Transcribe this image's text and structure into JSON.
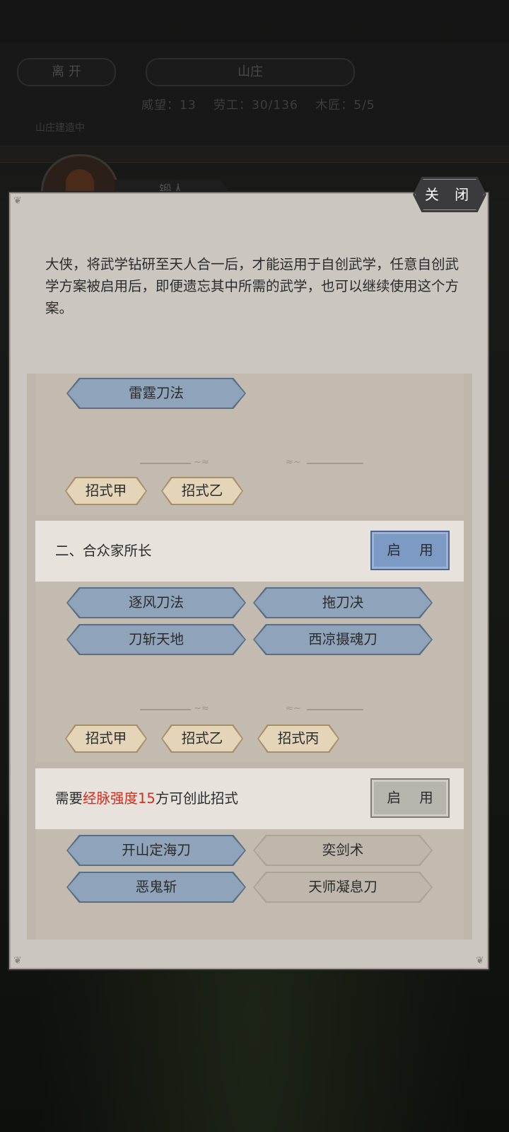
{
  "background": {
    "leave_label": "离 开",
    "title": "山庄",
    "stats": [
      "威望：13",
      "劳工：30/136",
      "木匠：5/5"
    ],
    "note": "山庄建造中",
    "name_plate": "锻人"
  },
  "modal": {
    "close_label": "关 闭",
    "intro": "大侠，将武学钻研至天人合一后，才能运用于自创武学，任意自创武学方案被启用后，即便遗忘其中所需的武学，也可以继续使用这个方案。"
  },
  "plans": [
    {
      "skills": [
        {
          "label": "雷霆刀法",
          "state": "unlocked"
        }
      ],
      "moves": [
        "招式甲",
        "招式乙"
      ]
    },
    {
      "title": "二、合众家所长",
      "enable_label": "启 用",
      "enable_state": "active",
      "skills": [
        {
          "label": "逐风刀法",
          "state": "unlocked"
        },
        {
          "label": "拖刀决",
          "state": "unlocked"
        },
        {
          "label": "刀斩天地",
          "state": "unlocked"
        },
        {
          "label": "西凉摄魂刀",
          "state": "unlocked"
        }
      ],
      "moves": [
        "招式甲",
        "招式乙",
        "招式丙"
      ]
    },
    {
      "title_prefix": "需要",
      "title_highlight": "经脉强度15",
      "title_suffix": "方可创此招式",
      "enable_label": "启 用",
      "enable_state": "inactive",
      "highlight_color": "#d62b18",
      "skills": [
        {
          "label": "开山定海刀",
          "state": "unlocked"
        },
        {
          "label": "奕剑术",
          "state": "locked"
        },
        {
          "label": "恶鬼斩",
          "state": "unlocked"
        },
        {
          "label": "天师凝息刀",
          "state": "locked"
        }
      ]
    }
  ]
}
